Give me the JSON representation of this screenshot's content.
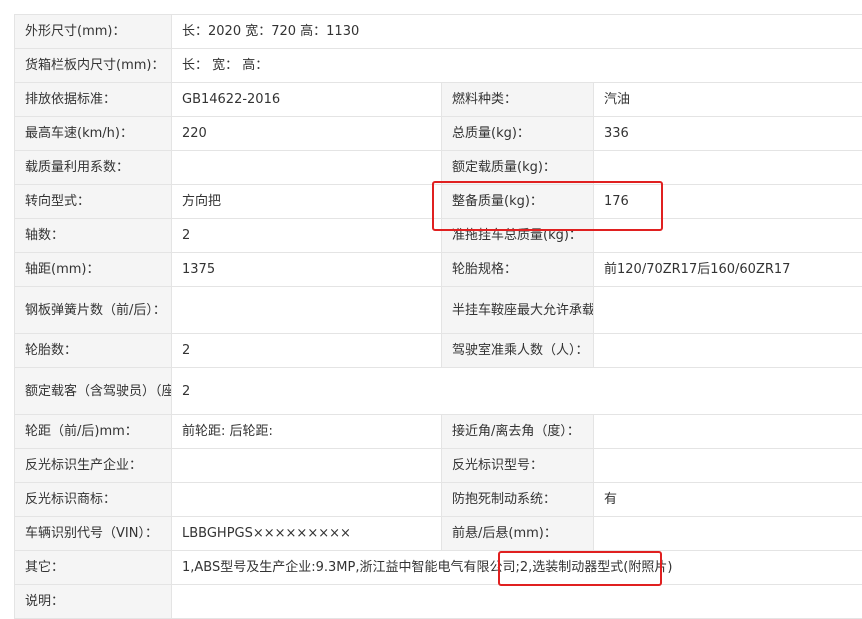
{
  "rows": [
    {
      "l1": "外形尺寸(mm)：",
      "v1": "长：2020 宽：720 高：1130"
    },
    {
      "l1": "货箱栏板内尺寸(mm)：",
      "v1": "长： 宽： 高："
    },
    {
      "l1": "排放依据标准：",
      "v1": "GB14622-2016",
      "l2": "燃料种类：",
      "v2": "汽油"
    },
    {
      "l1": "最高车速(km/h)：",
      "v1": "220",
      "l2": "总质量(kg)：",
      "v2": "336"
    },
    {
      "l1": "载质量利用系数：",
      "v1": "",
      "l2": "额定载质量(kg)：",
      "v2": ""
    },
    {
      "l1": "转向型式：",
      "v1": "方向把",
      "l2": "整备质量(kg)：",
      "v2": "176"
    },
    {
      "l1": "轴数：",
      "v1": "2",
      "l2": "准拖挂车总质量(kg)：",
      "v2": ""
    },
    {
      "l1": "轴距(mm)：",
      "v1": "1375",
      "l2": "轮胎规格：",
      "v2": "前120/70ZR17后160/60ZR17"
    },
    {
      "l1": "钢板弹簧片数（前/后）：",
      "v1": "",
      "l2": "半挂车鞍座最大允许承载质量(kg)：",
      "v2": ""
    },
    {
      "l1": "轮胎数：",
      "v1": "2",
      "l2": "驾驶室准乘人数（人）：",
      "v2": ""
    },
    {
      "l1": "额定载客（含驾驶员）（座位数）：",
      "v1": "2"
    },
    {
      "l1": "轮距（前/后)mm：",
      "v1": "前轮距: 后轮距:",
      "l2": "接近角/离去角（度）：",
      "v2": ""
    },
    {
      "l1": "反光标识生产企业：",
      "v1": "",
      "l2": "反光标识型号：",
      "v2": ""
    },
    {
      "l1": "反光标识商标：",
      "v1": "",
      "l2": "防抱死制动系统：",
      "v2": "有"
    },
    {
      "l1": "车辆识别代号（VIN）：",
      "v1": "LBBGHPGS×××××××××",
      "l2": "前悬/后悬(mm)：",
      "v2": ""
    },
    {
      "l1": "其它：",
      "v1": "1,ABS型号及生产企业:9.3MP,浙江益中智能电气有限公司;2,选装制动器型式(附照片)"
    },
    {
      "l1": "说明：",
      "v1": ""
    }
  ],
  "highlight_color": "#e02020"
}
